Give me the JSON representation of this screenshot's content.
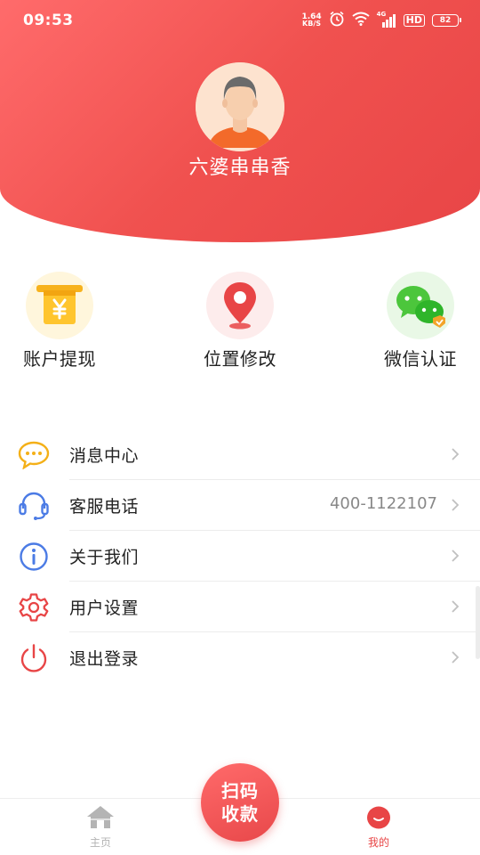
{
  "status_bar": {
    "time": "09:53",
    "net_speed_value": "1.64",
    "net_speed_unit": "KB/S",
    "network_type": "4G",
    "hd_label": "HD",
    "battery": "82"
  },
  "profile": {
    "username": "六婆串串香"
  },
  "quick_actions": [
    {
      "label": "账户提现",
      "icon": "yuan-withdraw-icon"
    },
    {
      "label": "位置修改",
      "icon": "location-pin-icon"
    },
    {
      "label": "微信认证",
      "icon": "wechat-verified-icon"
    }
  ],
  "menu": [
    {
      "label": "消息中心",
      "value": "",
      "icon": "message-bubble-icon"
    },
    {
      "label": "客服电话",
      "value": "400-1122107",
      "icon": "headset-icon"
    },
    {
      "label": "关于我们",
      "value": "",
      "icon": "info-icon"
    },
    {
      "label": "用户设置",
      "value": "",
      "icon": "gear-icon"
    },
    {
      "label": "退出登录",
      "value": "",
      "icon": "power-icon"
    }
  ],
  "scan_button": {
    "line1": "扫码",
    "line2": "收款"
  },
  "tabs": [
    {
      "label": "主页",
      "icon": "home-icon",
      "active": false
    },
    {
      "label": "我的",
      "icon": "profile-icon",
      "active": true
    }
  ],
  "colors": {
    "brand_red": "#e84546",
    "inactive_gray": "#b4b4b4",
    "divider": "#ececec"
  }
}
